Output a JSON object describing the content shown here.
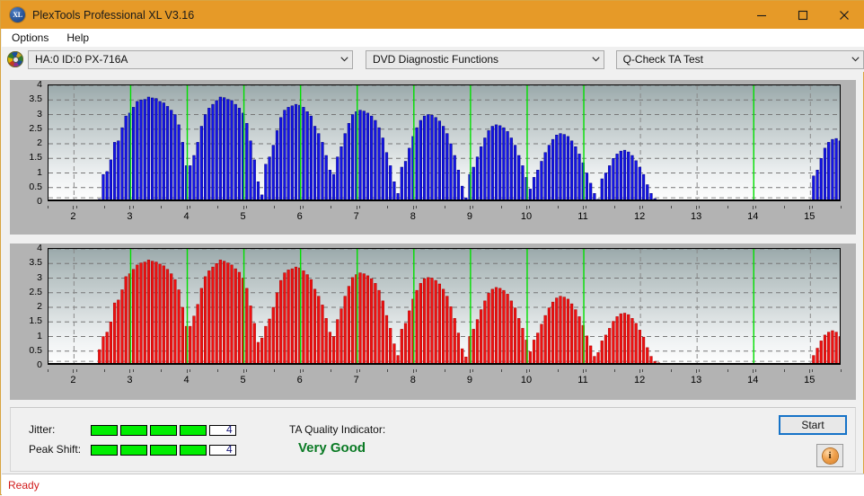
{
  "window": {
    "title": "PlexTools Professional XL V3.16",
    "icon": "xl-logo-icon",
    "controls": {
      "minimize": "minimize-icon",
      "maximize": "maximize-icon",
      "close": "close-icon"
    },
    "titlebar_color": "#e69a28"
  },
  "menu": {
    "items": [
      {
        "label": "Options"
      },
      {
        "label": "Help"
      }
    ]
  },
  "toolbar": {
    "drive_icon": "disc-icon",
    "drive_select": {
      "value": "HA:0 ID:0  PX-716A",
      "arrow": "chevron-down-icon"
    },
    "function_select": {
      "value": "DVD Diagnostic Functions",
      "arrow": "chevron-down-icon"
    },
    "test_select": {
      "value": "Q-Check TA Test",
      "arrow": "chevron-down-icon"
    }
  },
  "footer": {
    "jitter_label": "Jitter:",
    "jitter_value": "4",
    "jitter_filled": 4,
    "jitter_total": 5,
    "peakshift_label": "Peak Shift:",
    "peakshift_value": "4",
    "peakshift_filled": 4,
    "peakshift_total": 5,
    "quality_label": "TA Quality Indicator:",
    "quality_value": "Very Good",
    "quality_color": "#0a7a24",
    "meter_on_color": "#00ee00",
    "start_label": "Start",
    "info_label": "i"
  },
  "statusbar": {
    "text": "Ready",
    "color": "#d11a1a"
  },
  "chart_data": [
    {
      "id": "jitter-chart",
      "type": "bar",
      "title": "",
      "xlabel": "",
      "ylabel": "",
      "color": "#1414e6",
      "bar_edge_color": "#000080",
      "marker_color": "#00e000",
      "grid": true,
      "xlim": [
        1.55,
        15.55
      ],
      "ylim": [
        0,
        4
      ],
      "ytick_labels": [
        "0",
        "0.5",
        "1",
        "1.5",
        "2",
        "2.5",
        "3",
        "3.5",
        "4"
      ],
      "yticks": [
        0,
        0.5,
        1,
        1.5,
        2,
        2.5,
        3,
        3.5,
        4
      ],
      "xtick_labels": [
        "2",
        "3",
        "4",
        "5",
        "6",
        "7",
        "8",
        "9",
        "10",
        "11",
        "12",
        "13",
        "14",
        "15"
      ],
      "xticks": [
        2,
        3,
        4,
        5,
        6,
        7,
        8,
        9,
        10,
        11,
        12,
        13,
        14,
        15
      ],
      "markers": [
        3,
        4,
        5,
        6,
        7,
        8,
        9,
        10,
        11,
        14
      ],
      "x_start": 2.45,
      "x_step": 0.0667,
      "values": [
        0.1,
        0.95,
        1.05,
        1.45,
        2.05,
        2.1,
        2.55,
        2.95,
        3.05,
        3.25,
        3.45,
        3.5,
        3.52,
        3.6,
        3.57,
        3.55,
        3.45,
        3.4,
        3.28,
        3.15,
        3.0,
        2.65,
        2.05,
        1.25,
        1.25,
        1.6,
        2.05,
        2.6,
        3.0,
        3.22,
        3.35,
        3.48,
        3.6,
        3.58,
        3.52,
        3.48,
        3.35,
        3.22,
        3.05,
        2.7,
        2.1,
        1.45,
        0.7,
        0.25,
        1.3,
        1.55,
        1.95,
        2.45,
        2.9,
        3.15,
        3.25,
        3.3,
        3.35,
        3.32,
        3.25,
        3.1,
        2.95,
        2.6,
        2.35,
        2.05,
        1.6,
        1.1,
        0.95,
        1.55,
        1.9,
        2.35,
        2.7,
        3.0,
        3.1,
        3.15,
        3.12,
        3.05,
        2.95,
        2.8,
        2.55,
        2.2,
        1.7,
        1.25,
        0.7,
        0.3,
        1.2,
        1.4,
        1.85,
        2.25,
        2.55,
        2.8,
        2.95,
        3.0,
        2.98,
        2.9,
        2.78,
        2.6,
        2.35,
        2.0,
        1.6,
        1.1,
        0.55,
        0.15,
        0.95,
        1.2,
        1.55,
        1.9,
        2.2,
        2.45,
        2.6,
        2.65,
        2.62,
        2.55,
        2.42,
        2.2,
        1.95,
        1.6,
        1.25,
        0.85,
        0.45,
        0.85,
        1.1,
        1.4,
        1.7,
        1.95,
        2.15,
        2.3,
        2.35,
        2.32,
        2.25,
        2.1,
        1.9,
        1.65,
        1.35,
        1.0,
        0.65,
        0.3,
        0.1,
        0.8,
        1.0,
        1.25,
        1.5,
        1.65,
        1.75,
        1.78,
        1.72,
        1.6,
        1.42,
        1.2,
        0.95,
        0.6,
        0.3,
        0.12,
        0.08,
        0,
        0,
        0,
        0,
        0,
        0,
        0,
        0,
        0,
        0,
        0,
        0,
        0,
        0,
        0,
        0,
        0,
        0,
        0,
        0,
        0,
        0,
        0,
        0,
        0,
        0,
        0,
        0,
        0,
        0,
        0,
        0,
        0,
        0,
        0,
        0,
        0,
        0,
        0,
        0,
        0.9,
        1.1,
        1.5,
        1.85,
        2.05,
        2.15,
        2.18,
        2.1,
        1.95,
        1.15,
        1.1,
        0.2,
        0,
        0,
        0,
        0,
        0,
        0,
        0,
        0,
        0,
        0,
        0,
        0,
        0,
        0,
        0
      ]
    },
    {
      "id": "peakshift-chart",
      "type": "bar",
      "title": "",
      "xlabel": "",
      "ylabel": "",
      "color": "#ee1111",
      "bar_edge_color": "#aa0000",
      "marker_color": "#00e000",
      "grid": true,
      "xlim": [
        1.55,
        15.55
      ],
      "ylim": [
        0,
        4
      ],
      "ytick_labels": [
        "0",
        "0.5",
        "1",
        "1.5",
        "2",
        "2.5",
        "3",
        "3.5",
        "4"
      ],
      "yticks": [
        0,
        0.5,
        1,
        1.5,
        2,
        2.5,
        3,
        3.5,
        4
      ],
      "xtick_labels": [
        "2",
        "3",
        "4",
        "5",
        "6",
        "7",
        "8",
        "9",
        "10",
        "11",
        "12",
        "13",
        "14",
        "15"
      ],
      "xticks": [
        2,
        3,
        4,
        5,
        6,
        7,
        8,
        9,
        10,
        11,
        12,
        13,
        14,
        15
      ],
      "markers": [
        3,
        4,
        5,
        6,
        7,
        8,
        9,
        10,
        11,
        14
      ],
      "x_start": 2.45,
      "x_step": 0.0667,
      "values": [
        0.55,
        1.0,
        1.15,
        1.5,
        2.15,
        2.25,
        2.6,
        3.05,
        3.15,
        3.3,
        3.45,
        3.52,
        3.55,
        3.62,
        3.58,
        3.55,
        3.48,
        3.42,
        3.3,
        3.15,
        2.95,
        2.6,
        2.0,
        1.35,
        1.35,
        1.7,
        2.1,
        2.65,
        3.05,
        3.25,
        3.38,
        3.5,
        3.62,
        3.58,
        3.52,
        3.45,
        3.32,
        3.2,
        3.0,
        2.65,
        2.05,
        1.45,
        0.8,
        0.95,
        1.35,
        1.6,
        2.0,
        2.5,
        2.92,
        3.18,
        3.28,
        3.32,
        3.38,
        3.35,
        3.25,
        3.12,
        2.95,
        2.62,
        2.38,
        2.08,
        1.62,
        1.15,
        1.0,
        1.58,
        1.95,
        2.38,
        2.72,
        3.02,
        3.12,
        3.18,
        3.15,
        3.08,
        2.98,
        2.82,
        2.58,
        2.22,
        1.72,
        1.28,
        0.75,
        0.35,
        1.25,
        1.45,
        1.88,
        2.28,
        2.58,
        2.82,
        2.98,
        3.02,
        3.0,
        2.92,
        2.8,
        2.62,
        2.38,
        2.02,
        1.62,
        1.12,
        0.58,
        0.3,
        1.0,
        1.25,
        1.58,
        1.92,
        2.22,
        2.48,
        2.62,
        2.68,
        2.65,
        2.58,
        2.45,
        2.22,
        1.98,
        1.62,
        1.28,
        0.88,
        0.48,
        0.88,
        1.12,
        1.42,
        1.72,
        1.98,
        2.18,
        2.32,
        2.38,
        2.35,
        2.28,
        2.12,
        1.92,
        1.68,
        1.38,
        1.02,
        0.68,
        0.32,
        0.45,
        0.85,
        1.05,
        1.28,
        1.52,
        1.68,
        1.78,
        1.8,
        1.75,
        1.62,
        1.45,
        1.22,
        0.98,
        0.62,
        0.32,
        0.15,
        0.1,
        0,
        0,
        0,
        0,
        0,
        0,
        0,
        0,
        0,
        0,
        0,
        0,
        0,
        0,
        0,
        0,
        0,
        0,
        0,
        0,
        0,
        0,
        0,
        0,
        0,
        0,
        0,
        0,
        0,
        0,
        0,
        0,
        0,
        0,
        0,
        0,
        0,
        0,
        0,
        0,
        0.35,
        0.6,
        0.85,
        1.05,
        1.15,
        1.2,
        1.15,
        1.0,
        0.72,
        0.7,
        0.25,
        0.1,
        0,
        0,
        0,
        0,
        0,
        0,
        0,
        0,
        0,
        0,
        0,
        0,
        0,
        0,
        0
      ]
    }
  ]
}
